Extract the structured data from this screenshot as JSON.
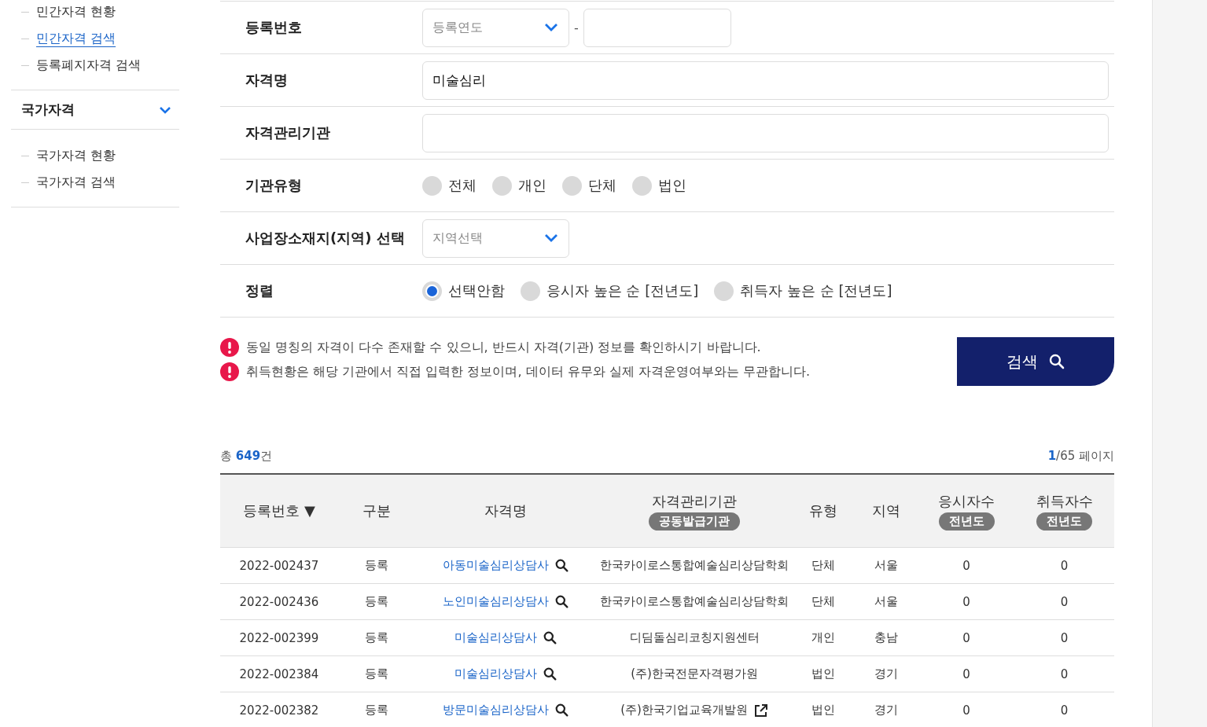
{
  "sidebar": {
    "top_items": [
      {
        "label": "민간자격 현황",
        "selected": false
      },
      {
        "label": "민간자격 검색",
        "selected": true
      },
      {
        "label": "등록폐지자격 검색",
        "selected": false
      }
    ],
    "sections": [
      {
        "title": "국가자격",
        "expanded": true,
        "items": [
          {
            "label": "국가자격 현황",
            "selected": false
          },
          {
            "label": "국가자격 검색",
            "selected": false
          }
        ]
      }
    ]
  },
  "form": {
    "rows": [
      {
        "kind": "year_number",
        "label": "등록번호",
        "placeholder": "등록연도",
        "separator": "-"
      },
      {
        "kind": "text",
        "label": "자격명",
        "value": "미술심리"
      },
      {
        "kind": "text",
        "label": "자격관리기관"
      },
      {
        "kind": "radio",
        "label": "기관유형",
        "options": [
          {
            "label": "전체",
            "selected": false
          },
          {
            "label": "개인",
            "selected": false
          },
          {
            "label": "단체",
            "selected": false
          },
          {
            "label": "법인",
            "selected": false
          }
        ]
      },
      {
        "kind": "select",
        "label": "사업장소재지(지역) 선택",
        "placeholder": "지역선택"
      },
      {
        "kind": "radio",
        "label": "정렬",
        "options": [
          {
            "label": "선택안함",
            "selected": true
          },
          {
            "label": "응시자 높은 순 [전년도]",
            "selected": false
          },
          {
            "label": "취득자 높은 순 [전년도]",
            "selected": false
          }
        ]
      }
    ]
  },
  "notices": [
    "동일 명칭의 자격이 다수 존재할 수 있으니, 반드시 자격(기관) 정보를 확인하시기 바랍니다.",
    "취득현황은 해당 기관에서 직접 입력한 정보이며, 데이터 유무와 실제 자격운영여부와는 무관합니다."
  ],
  "search_button": {
    "label": "검색"
  },
  "results": {
    "total_prefix": "총",
    "count": "649",
    "count_suffix": "건",
    "page_current": "1",
    "page_rest": "/65 페이지"
  },
  "table": {
    "columns": [
      {
        "label": "등록번호",
        "sort_mark": "▼"
      },
      {
        "label": "구분"
      },
      {
        "label": "자격명"
      },
      {
        "label": "자격관리기관",
        "badge": "공동발급기관"
      },
      {
        "label": "유형"
      },
      {
        "label": "지역"
      },
      {
        "label": "응시자수",
        "badge": "전년도"
      },
      {
        "label": "취득자수",
        "badge": "전년도"
      }
    ],
    "rows": [
      {
        "number": "2022-002437",
        "status": "등록",
        "name": "아동미술심리상담사",
        "org": "한국카이로스통합예술심리상담학회",
        "org_link": false,
        "type": "단체",
        "region": "서울",
        "applicants": "0",
        "acquirers": "0"
      },
      {
        "number": "2022-002436",
        "status": "등록",
        "name": "노인미술심리상담사",
        "org": "한국카이로스통합예술심리상담학회",
        "org_link": false,
        "type": "단체",
        "region": "서울",
        "applicants": "0",
        "acquirers": "0"
      },
      {
        "number": "2022-002399",
        "status": "등록",
        "name": "미술심리상담사",
        "org": "디딤돌심리코칭지원센터",
        "org_link": false,
        "type": "개인",
        "region": "충남",
        "applicants": "0",
        "acquirers": "0"
      },
      {
        "number": "2022-002384",
        "status": "등록",
        "name": "미술심리상담사",
        "org": "(주)한국전문자격평가원",
        "org_link": false,
        "type": "법인",
        "region": "경기",
        "applicants": "0",
        "acquirers": "0"
      },
      {
        "number": "2022-002382",
        "status": "등록",
        "name": "방문미술심리상담사",
        "org": "(주)한국기업교육개발원",
        "org_link": true,
        "type": "법인",
        "region": "경기",
        "applicants": "0",
        "acquirers": "0"
      }
    ]
  }
}
